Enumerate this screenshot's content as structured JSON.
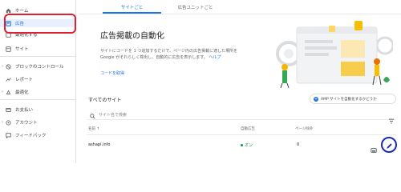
{
  "sidebar": {
    "items": [
      {
        "label": "ホーム",
        "icon": "home-icon"
      },
      {
        "label": "広告",
        "icon": "ads-icon",
        "active": true
      },
      {
        "label": "最適化する",
        "icon": "optimize-icon"
      },
      {
        "label": "サイト",
        "icon": "sites-icon"
      },
      {
        "label": "ブロックのコントロール",
        "icon": "block-icon"
      },
      {
        "label": "レポート",
        "icon": "report-icon"
      },
      {
        "label": "最適化",
        "icon": "optimization-icon"
      },
      {
        "label": "お支払い",
        "icon": "payments-icon"
      },
      {
        "label": "アカウント",
        "icon": "account-icon"
      },
      {
        "label": "フィードバック",
        "icon": "feedback-icon"
      }
    ]
  },
  "tabs": [
    {
      "label": "サイトごと",
      "active": true
    },
    {
      "label": "広告ユニットごと",
      "active": false
    }
  ],
  "hero": {
    "title": "広告掲載の自動化",
    "description": "サイトにコードを 1 つ追加するだけで、ページ内の広告掲載に適した場所を Google がそれらしく検出し、自動的に広告を表示します。",
    "help_link": "ヘルプ",
    "get_code": "コードを取得"
  },
  "sites": {
    "title": "すべてのサイト",
    "amp_button": "AMP サイトを自動化するかどうか",
    "search_placeholder": "サイト名で検索",
    "columns": {
      "site": "名前 ↑",
      "auto_ads": "自動広告",
      "page_exclusions": "ページ除外"
    },
    "rows": [
      {
        "site": "ashapi.info",
        "auto_ads": "オン",
        "page_exclusions": "0"
      }
    ]
  },
  "colors": {
    "accent": "#1a73e8",
    "highlight_red": "#e0202e",
    "status_green": "#1e8e3e",
    "edit_ring": "#1a2bb5"
  }
}
